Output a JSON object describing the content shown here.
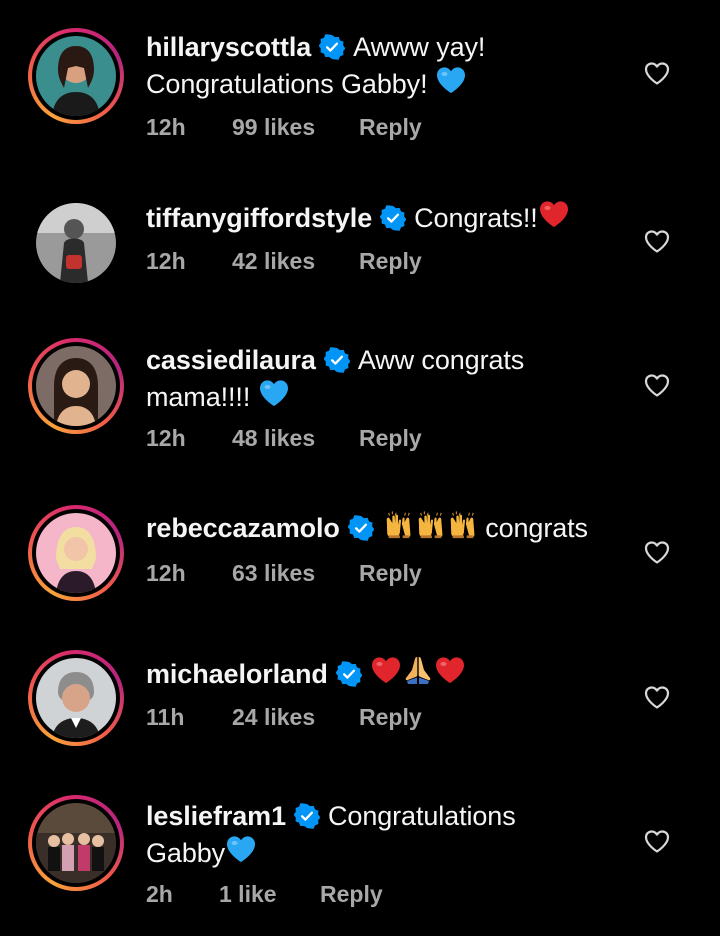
{
  "comments": [
    {
      "username": "hillaryscottla",
      "text_line1": "Awww yay!",
      "text_line2": "Congratulations Gabby!",
      "emoji": "blue-heart",
      "time": "12h",
      "likes": "99 likes",
      "reply": "Reply"
    },
    {
      "username": "tiffanygiffordstyle",
      "text_line1": "Congrats!!",
      "emoji": "red-heart",
      "time": "12h",
      "likes": "42 likes",
      "reply": "Reply"
    },
    {
      "username": "cassiedilaura",
      "text_line1": "Aww congrats",
      "text_line2": "mama!!!!",
      "emoji": "blue-heart",
      "time": "12h",
      "likes": "48 likes",
      "reply": "Reply"
    },
    {
      "username": "rebeccazamolo",
      "text_line1": "congrats",
      "emoji": "raising-hands-x3",
      "time": "12h",
      "likes": "63 likes",
      "reply": "Reply"
    },
    {
      "username": "michaelorland",
      "text_line1": "",
      "emoji": "red-heart folded-hands red-heart",
      "time": "11h",
      "likes": "24 likes",
      "reply": "Reply"
    },
    {
      "username": "lesliefram1",
      "text_line1": "Congratulations",
      "text_line2": "Gabby",
      "emoji": "blue-heart",
      "time": "2h",
      "likes": "1 like",
      "reply": "Reply"
    }
  ],
  "colors": {
    "background": "#000000",
    "text": "#f5f5f5",
    "meta": "#a8a8a8",
    "verified": "#0095f6",
    "blue_heart": "#2aa7f2",
    "red_heart": "#e0252d"
  }
}
